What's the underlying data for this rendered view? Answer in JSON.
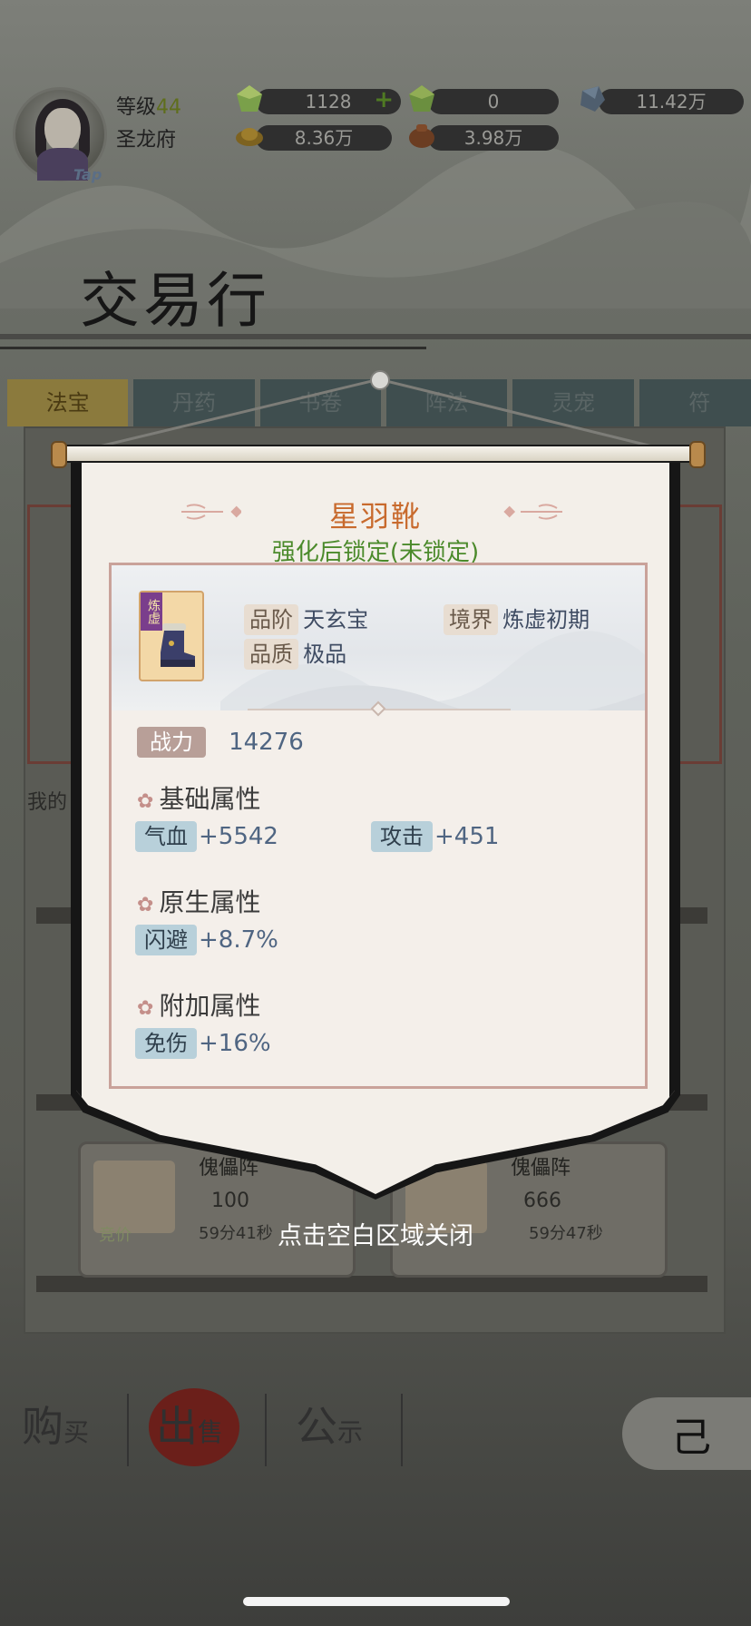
{
  "player": {
    "level_label": "等级",
    "level_value": "44",
    "sect": "圣龙府",
    "tap_label": "Tap"
  },
  "resources": [
    {
      "icon": "jade-gem-icon",
      "value": "1128",
      "has_plus": true
    },
    {
      "icon": "spirit-gem-icon",
      "value": "0"
    },
    {
      "icon": "blue-stone-icon",
      "value": "11.42万"
    },
    {
      "icon": "gold-ingot-icon",
      "value": "8.36万"
    },
    {
      "icon": "bronze-pot-icon",
      "value": "3.98万"
    }
  ],
  "screen_title": "交易行",
  "tabs": [
    "法宝",
    "丹药",
    "书卷",
    "阵法",
    "灵宠",
    "符"
  ],
  "mine_text": "我的",
  "listings": [
    {
      "name": "傀儡阵",
      "price": "100",
      "timer": "59分41秒",
      "bid_label": "竞价"
    },
    {
      "name": "傀儡阵",
      "price": "666",
      "timer": "59分47秒"
    }
  ],
  "bottom_nav": [
    {
      "big": "购",
      "small": "买"
    },
    {
      "big": "出",
      "small": "售"
    },
    {
      "big": "公",
      "small": "示"
    }
  ],
  "back_label": "己",
  "modal": {
    "item_name": "星羽靴",
    "lock_status": "强化后锁定(未锁定)",
    "icon_tag": "炼虚",
    "grade_label": "品阶",
    "grade_value": "天玄宝",
    "realm_label": "境界",
    "realm_value": "炼虚初期",
    "quality_label": "品质",
    "quality_value": "极品",
    "power_label": "战力",
    "power_value": "14276",
    "base_title": "基础属性",
    "base_stats": [
      {
        "label": "气血",
        "value": "+5542"
      },
      {
        "label": "攻击",
        "value": "+451"
      }
    ],
    "native_title": "原生属性",
    "native_stats": [
      {
        "label": "闪避",
        "value": "+8.7%"
      }
    ],
    "extra_title": "附加属性",
    "extra_stats": [
      {
        "label": "免伤",
        "value": "+16%"
      }
    ]
  },
  "close_hint": "点击空白区域关闭",
  "colors": {
    "item_name": "#c86a2d",
    "lock_status": "#4b8a2b",
    "stat_chip": "#b8d0da",
    "power_chip": "#b89f98"
  }
}
